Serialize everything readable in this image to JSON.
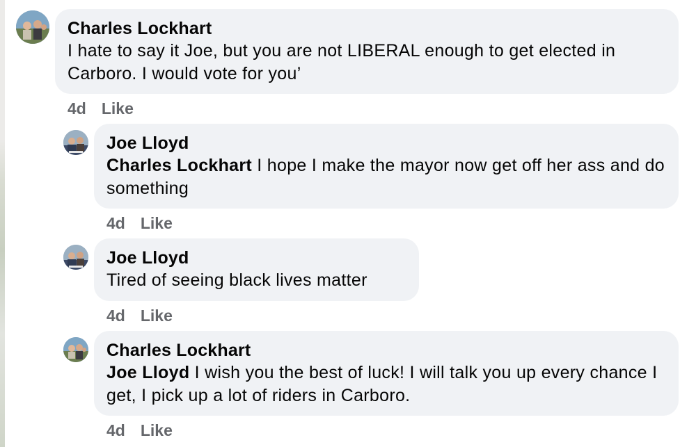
{
  "comments": [
    {
      "author": "Charles Lockhart",
      "mention": "",
      "text": "I hate to say it Joe, but you are not LIBERAL enough to get elected in Carboro. I would vote for you’",
      "time": "4d",
      "like": "Like"
    },
    {
      "author": "Joe Lloyd",
      "mention": "Charles Lockhart",
      "text": "I hope I make the mayor now get off her ass and do something",
      "time": "4d",
      "like": "Like"
    },
    {
      "author": "Joe Lloyd",
      "mention": "",
      "text": "Tired of seeing black lives matter",
      "time": "4d",
      "like": "Like"
    },
    {
      "author": "Charles Lockhart",
      "mention": "Joe Lloyd",
      "text": "I wish you the best of luck! I will talk you up every chance I get, I pick up a lot of riders in Carboro.",
      "time": "4d",
      "like": "Like"
    }
  ]
}
